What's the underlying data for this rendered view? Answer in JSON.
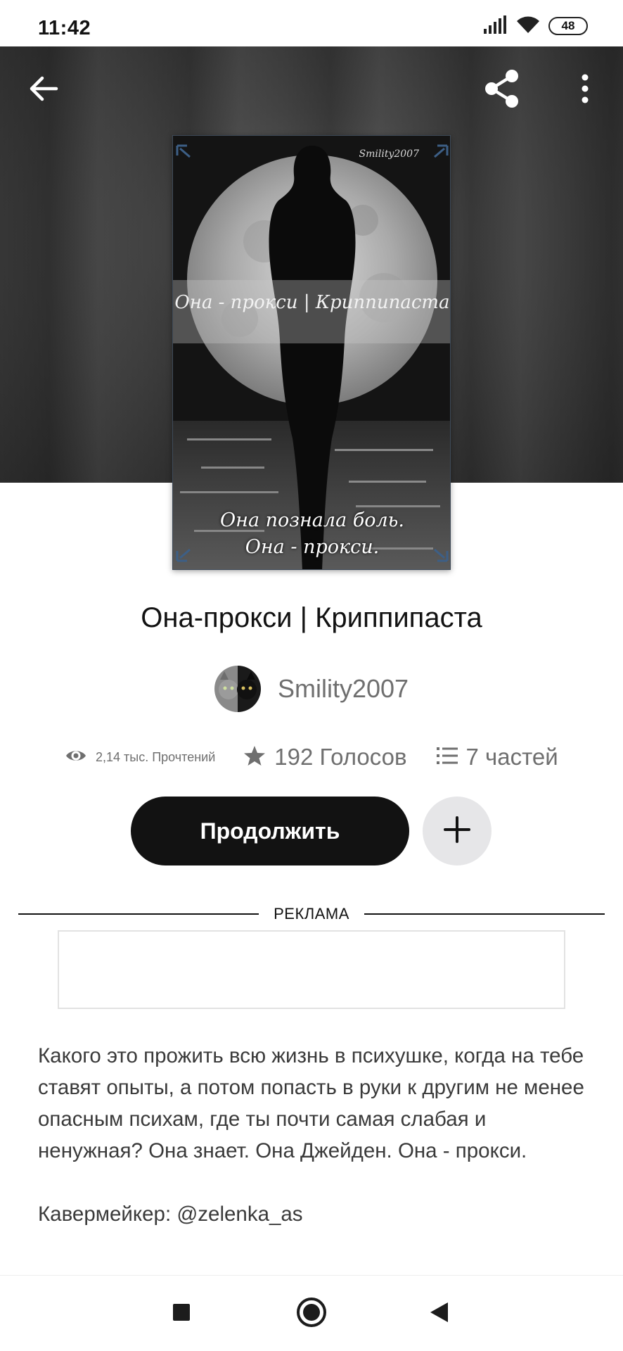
{
  "status_bar": {
    "time": "11:42",
    "battery": "48",
    "icons": [
      "signal-icon",
      "wifi-icon",
      "battery-icon"
    ]
  },
  "toolbar": {
    "icons": [
      "back-arrow-icon",
      "share-icon",
      "more-vertical-icon"
    ]
  },
  "cover": {
    "author_mark": "Smility2007",
    "title": "Она - прокси | Криппипаста",
    "tagline_line1": "Она познала боль.",
    "tagline_line2": "Она - прокси."
  },
  "book": {
    "title": "Она-прокси | Криппипаста",
    "author": "Smility2007"
  },
  "stats": {
    "reads": "2,14 тыс. Прочтений",
    "votes": "192 Голосов",
    "parts": "7 частей",
    "icons": [
      "eye-icon",
      "star-icon",
      "list-icon"
    ]
  },
  "actions": {
    "continue_label": "Продолжить",
    "add_icon": "plus-icon"
  },
  "ad": {
    "label": "РЕКЛАМА"
  },
  "description": {
    "paragraph1": "Какого это прожить всю жизнь в психушке, когда на тебе ставят опыты, а потом попасть в руки к другим не менее опасным психам, где ты почти самая слабая и ненужная? Она знает. Она Джейден. Она - прокси.",
    "paragraph2": "Кавермейкер: @zelenka_as"
  },
  "nav": {
    "icons": [
      "recents-square-icon",
      "home-circle-icon",
      "back-triangle-icon"
    ]
  },
  "colors": {
    "primary_button": "#121212",
    "secondary_button": "#e6e6e8",
    "muted_text": "#6f6f6f",
    "hero_background": "#3a3a3a"
  }
}
